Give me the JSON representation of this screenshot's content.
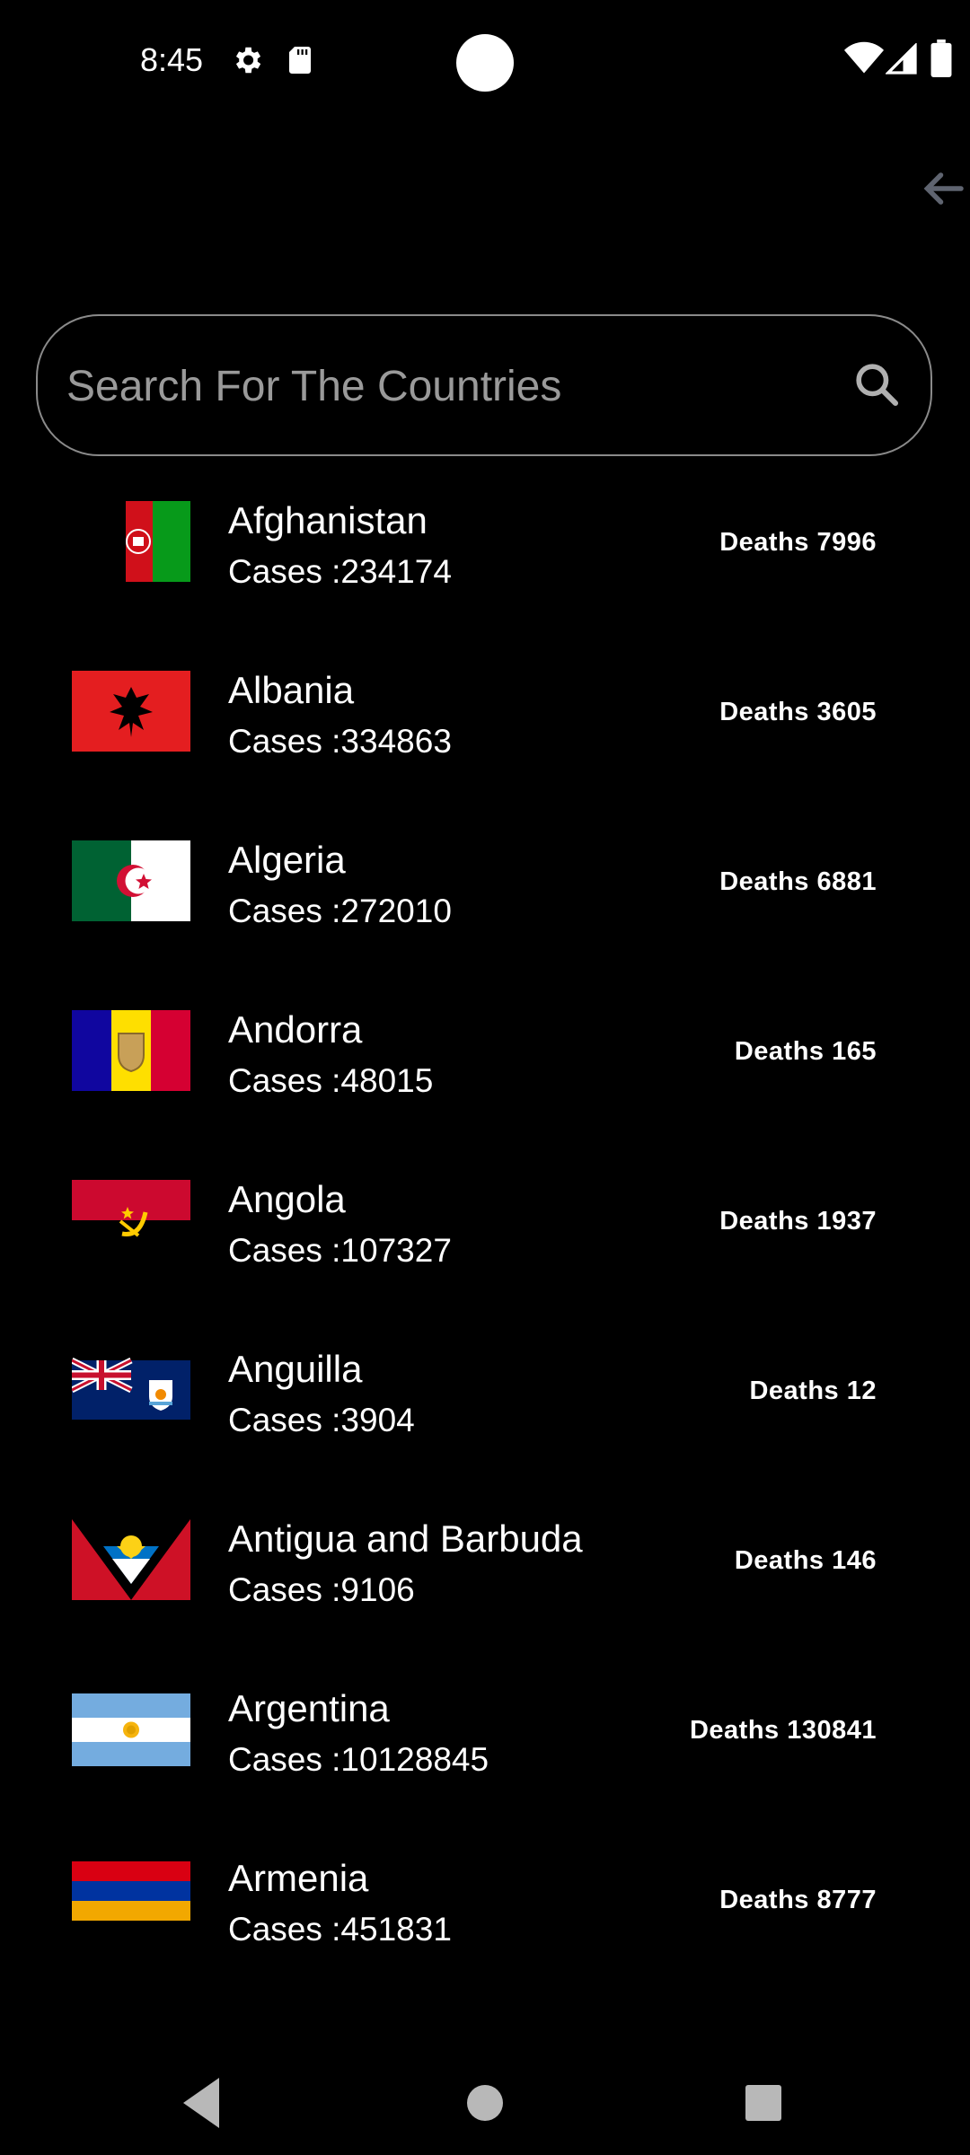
{
  "status": {
    "time": "8:45",
    "icons": [
      "gear-icon",
      "sd-card-icon",
      "wifi-icon",
      "signal-icon",
      "battery-icon"
    ]
  },
  "header": {
    "back_icon": "arrow-back-icon"
  },
  "search": {
    "placeholder": "Search For The Countries",
    "icon": "search-icon"
  },
  "countries": [
    {
      "name": "Afghanistan",
      "cases": "Cases :234174",
      "deaths": "Deaths 7996"
    },
    {
      "name": "Albania",
      "cases": "Cases :334863",
      "deaths": "Deaths 3605"
    },
    {
      "name": "Algeria",
      "cases": "Cases :272010",
      "deaths": "Deaths 6881"
    },
    {
      "name": "Andorra",
      "cases": "Cases :48015",
      "deaths": "Deaths 165"
    },
    {
      "name": "Angola",
      "cases": "Cases :107327",
      "deaths": "Deaths 1937"
    },
    {
      "name": "Anguilla",
      "cases": "Cases :3904",
      "deaths": "Deaths 12"
    },
    {
      "name": "Antigua and Barbuda",
      "cases": "Cases :9106",
      "deaths": "Deaths 146"
    },
    {
      "name": "Argentina",
      "cases": "Cases :10128845",
      "deaths": "Deaths 130841"
    },
    {
      "name": "Armenia",
      "cases": "Cases :451831",
      "deaths": "Deaths 8777"
    }
  ],
  "nav": {
    "back": "nav-back-icon",
    "home": "nav-home-icon",
    "recents": "nav-recents-icon"
  }
}
